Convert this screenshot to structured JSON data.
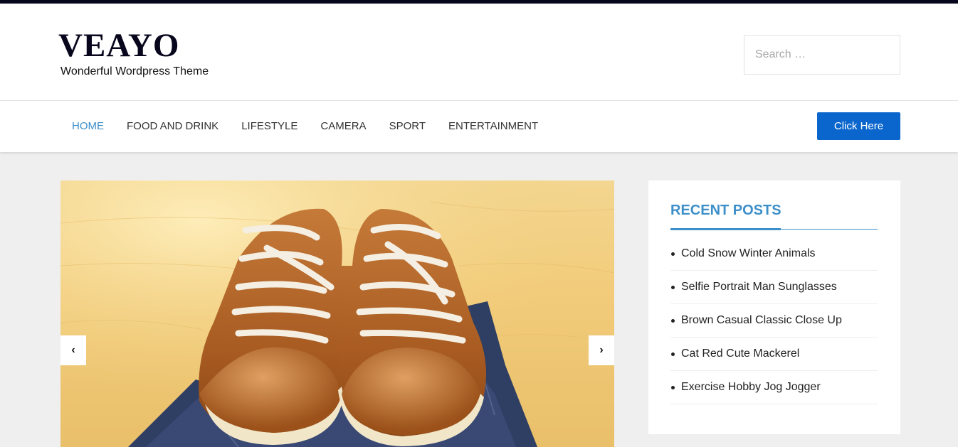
{
  "brand": {
    "title": "VEAYO",
    "tagline": "Wonderful Wordpress Theme"
  },
  "search": {
    "placeholder": "Search …",
    "value": ""
  },
  "nav": {
    "items": [
      {
        "label": "HOME",
        "active": true
      },
      {
        "label": "FOOD AND DRINK",
        "active": false
      },
      {
        "label": "LIFESTYLE",
        "active": false
      },
      {
        "label": "CAMERA",
        "active": false
      },
      {
        "label": "SPORT",
        "active": false
      },
      {
        "label": "ENTERTAINMENT",
        "active": false
      }
    ],
    "cta_label": "Click Here"
  },
  "slider": {
    "image": "brown-leather-sneakers-on-jeans-photo",
    "prev_icon": "chevron-left-icon",
    "next_icon": "chevron-right-icon"
  },
  "sidebar": {
    "widget_title": "RECENT POSTS",
    "posts": [
      "Cold Snow Winter Animals",
      "Selfie Portrait Man Sunglasses",
      "Brown Casual Classic Close Up",
      "Cat Red Cute Mackerel",
      "Exercise Hobby Jog Jogger"
    ]
  },
  "colors": {
    "topbar": "#07061c",
    "accent": "#3d8fc9",
    "button": "#0a66cc",
    "page_bg": "#efefef"
  }
}
